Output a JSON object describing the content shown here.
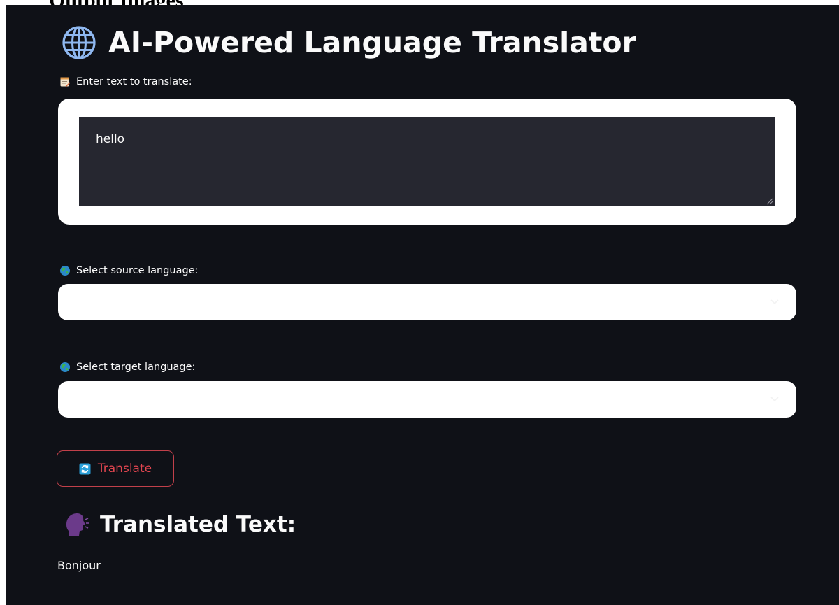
{
  "page_header_cut": "Output Images",
  "app": {
    "title": "AI-Powered Language Translator",
    "title_icon": "globe-icon",
    "colors": {
      "background": "#0f1117",
      "text": "#fafafa",
      "input_dark": "#262730",
      "button_accent": "#e0454f"
    }
  },
  "input_section": {
    "label": "Enter text to translate:",
    "label_icon": "memo-icon",
    "value": "hello"
  },
  "source_language": {
    "label": "Select source language:",
    "label_icon": "earth-globe-icon",
    "selected": ""
  },
  "target_language": {
    "label": "Select target language:",
    "label_icon": "earth-globe-icon",
    "selected": ""
  },
  "translate_button": {
    "label": "Translate",
    "icon": "refresh-icon"
  },
  "result": {
    "heading": "Translated Text:",
    "heading_icon": "speaking-head-icon",
    "text": "Bonjour"
  }
}
